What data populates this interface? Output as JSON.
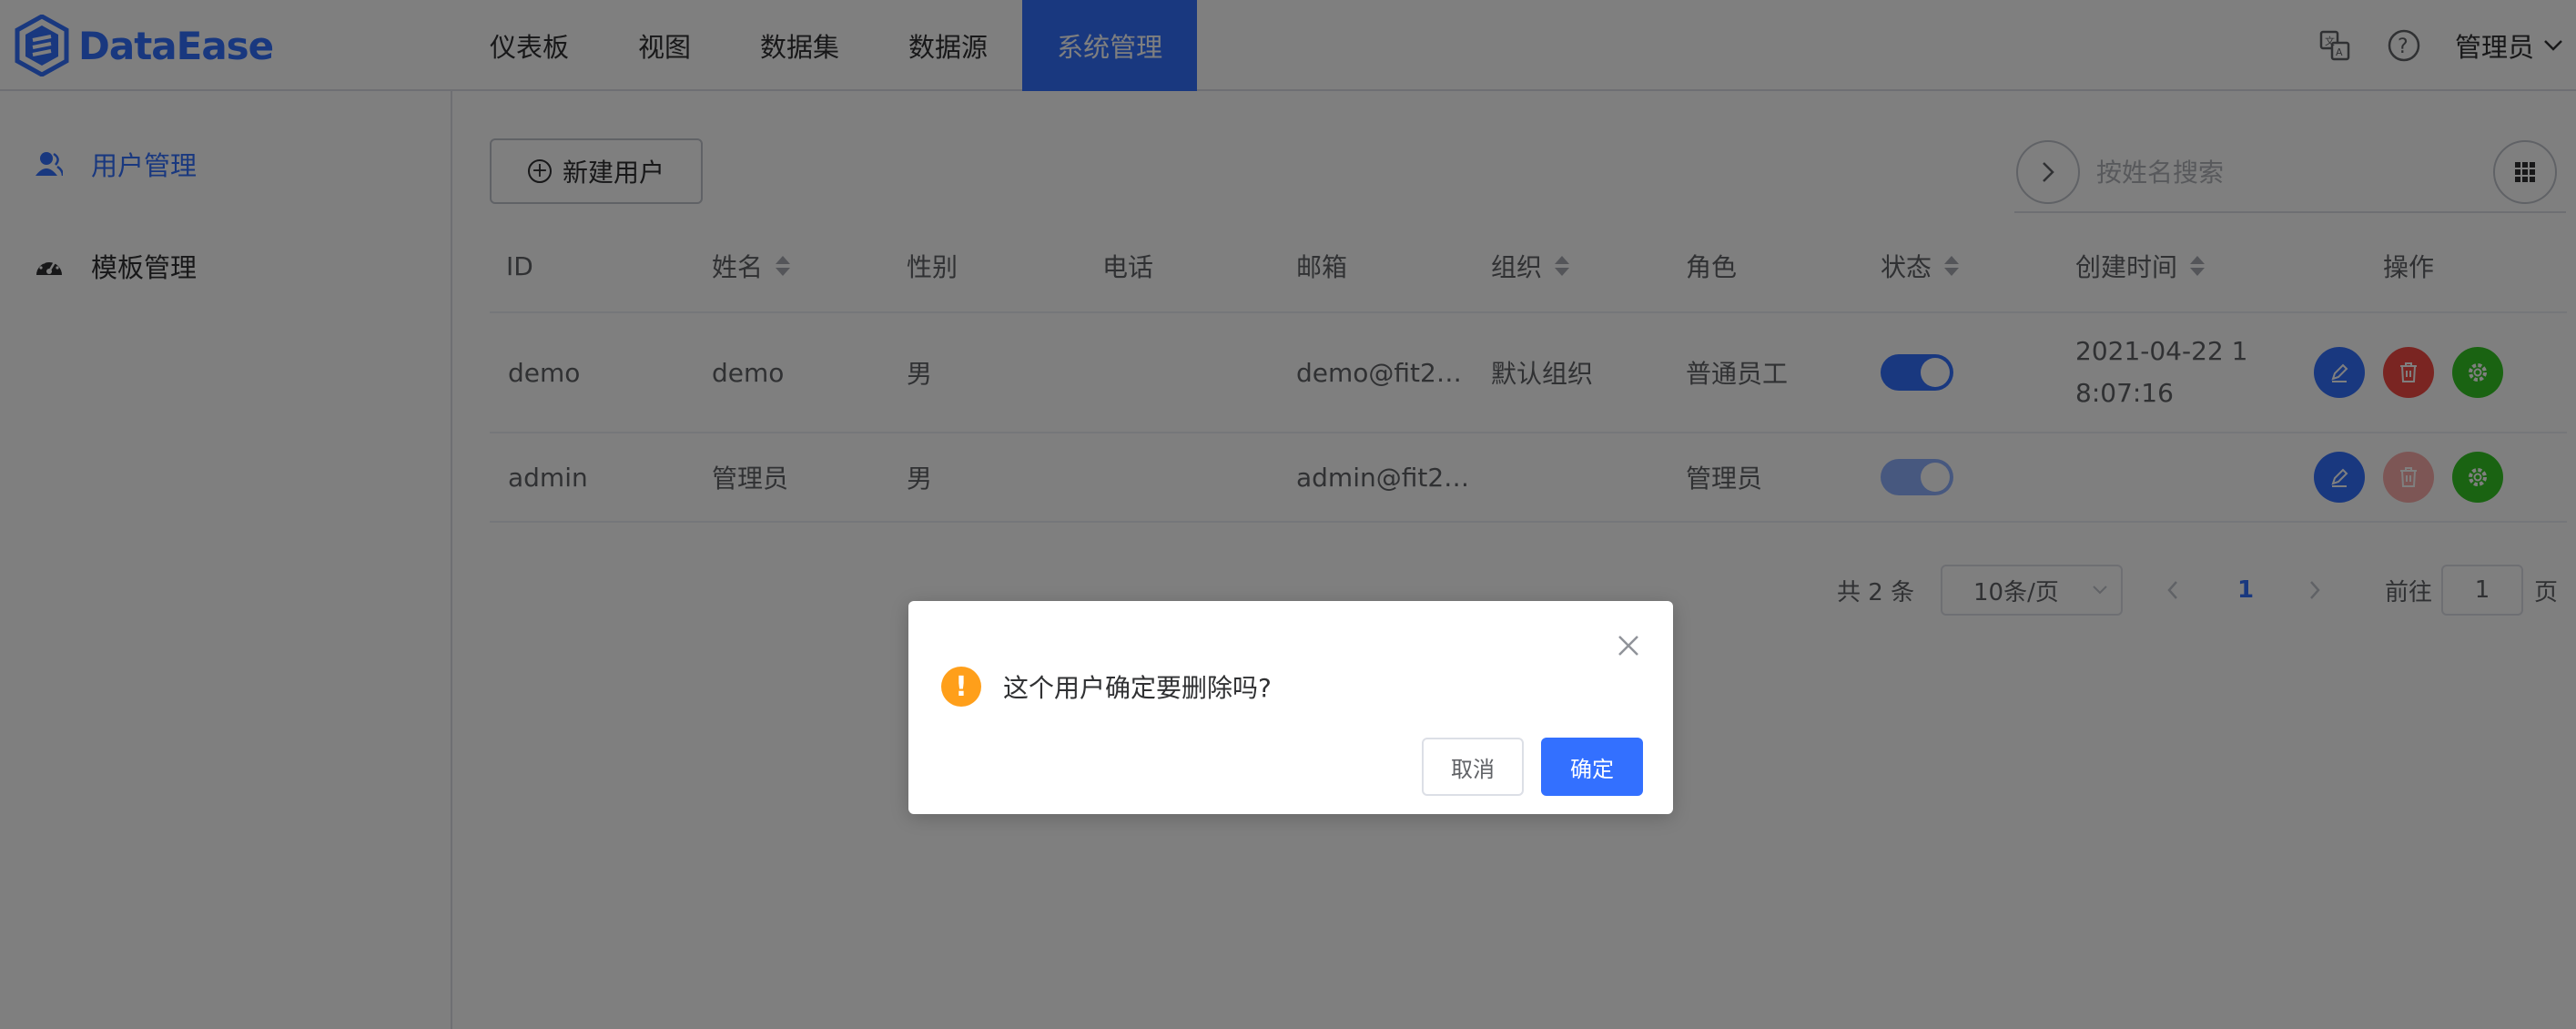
{
  "header": {
    "logo_text": "DataEase",
    "nav": [
      {
        "label": "仪表板"
      },
      {
        "label": "视图"
      },
      {
        "label": "数据集"
      },
      {
        "label": "数据源"
      },
      {
        "label": "系统管理",
        "active": true
      }
    ],
    "user": "管理员"
  },
  "sidebar": {
    "items": [
      {
        "label": "用户管理",
        "icon": "user-icon",
        "active": true
      },
      {
        "label": "模板管理",
        "icon": "dashboard-icon",
        "active": false
      }
    ]
  },
  "toolbar": {
    "new_user_label": "新建用户",
    "search_placeholder": "按姓名搜索"
  },
  "table": {
    "headers": {
      "id": "ID",
      "name": "姓名",
      "gender": "性别",
      "phone": "电话",
      "email": "邮箱",
      "org": "组织",
      "role": "角色",
      "status": "状态",
      "created": "创建时间",
      "actions": "操作"
    },
    "rows": [
      {
        "id": "demo",
        "name": "demo",
        "gender": "男",
        "phone": "",
        "email": "demo@fit2…",
        "org": "默认组织",
        "role": "普通员工",
        "status_on": true,
        "status_disabled": false,
        "created_line1": "2021-04-22 1",
        "created_line2": "8:07:16",
        "delete_disabled": false
      },
      {
        "id": "admin",
        "name": "管理员",
        "gender": "男",
        "phone": "",
        "email": "admin@fit2…",
        "org": "",
        "role": "管理员",
        "status_on": true,
        "status_disabled": true,
        "created_line1": "",
        "created_line2": "",
        "delete_disabled": true
      }
    ]
  },
  "pagination": {
    "total": "共 2 条",
    "page_size": "10条/页",
    "current": "1",
    "goto_label": "前往",
    "goto_value": "1",
    "page_suffix": "页"
  },
  "dialog": {
    "message": "这个用户确定要删除吗?",
    "cancel_label": "取消",
    "confirm_label": "确定"
  },
  "colors": {
    "accent": "#3370ff",
    "danger": "#f54a45",
    "success": "#34c724",
    "warning": "#ff9f1a"
  }
}
